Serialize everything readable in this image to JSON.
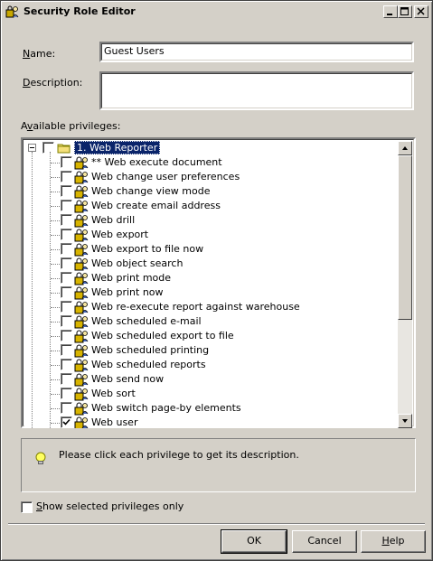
{
  "window": {
    "title": "Security Role Editor"
  },
  "form": {
    "name_label": "Name:",
    "name_value": "Guest Users",
    "description_label": "Description:",
    "description_value": "",
    "available_label": "Available privileges:"
  },
  "tree": {
    "root_label": "1. Web Reporter",
    "items": [
      {
        "label": "** Web execute document",
        "checked": false
      },
      {
        "label": "Web change user preferences",
        "checked": false
      },
      {
        "label": "Web change view mode",
        "checked": false
      },
      {
        "label": "Web create email address",
        "checked": false
      },
      {
        "label": "Web drill",
        "checked": false
      },
      {
        "label": "Web export",
        "checked": false
      },
      {
        "label": "Web export to file now",
        "checked": false
      },
      {
        "label": "Web object search",
        "checked": false
      },
      {
        "label": "Web print mode",
        "checked": false
      },
      {
        "label": "Web print now",
        "checked": false
      },
      {
        "label": "Web re-execute report against warehouse",
        "checked": false
      },
      {
        "label": "Web scheduled e-mail",
        "checked": false
      },
      {
        "label": "Web scheduled export to file",
        "checked": false
      },
      {
        "label": "Web scheduled printing",
        "checked": false
      },
      {
        "label": "Web scheduled reports",
        "checked": false
      },
      {
        "label": "Web send now",
        "checked": false
      },
      {
        "label": "Web sort",
        "checked": false
      },
      {
        "label": "Web switch page-by elements",
        "checked": false
      },
      {
        "label": "Web user",
        "checked": true
      }
    ]
  },
  "description_panel": {
    "icon": "lightbulb-icon",
    "text": "Please click each privilege to get its description."
  },
  "options": {
    "show_selected_label": "Show selected privileges only",
    "show_selected_checked": false
  },
  "buttons": {
    "ok": "OK",
    "cancel": "Cancel",
    "help": "Help"
  }
}
